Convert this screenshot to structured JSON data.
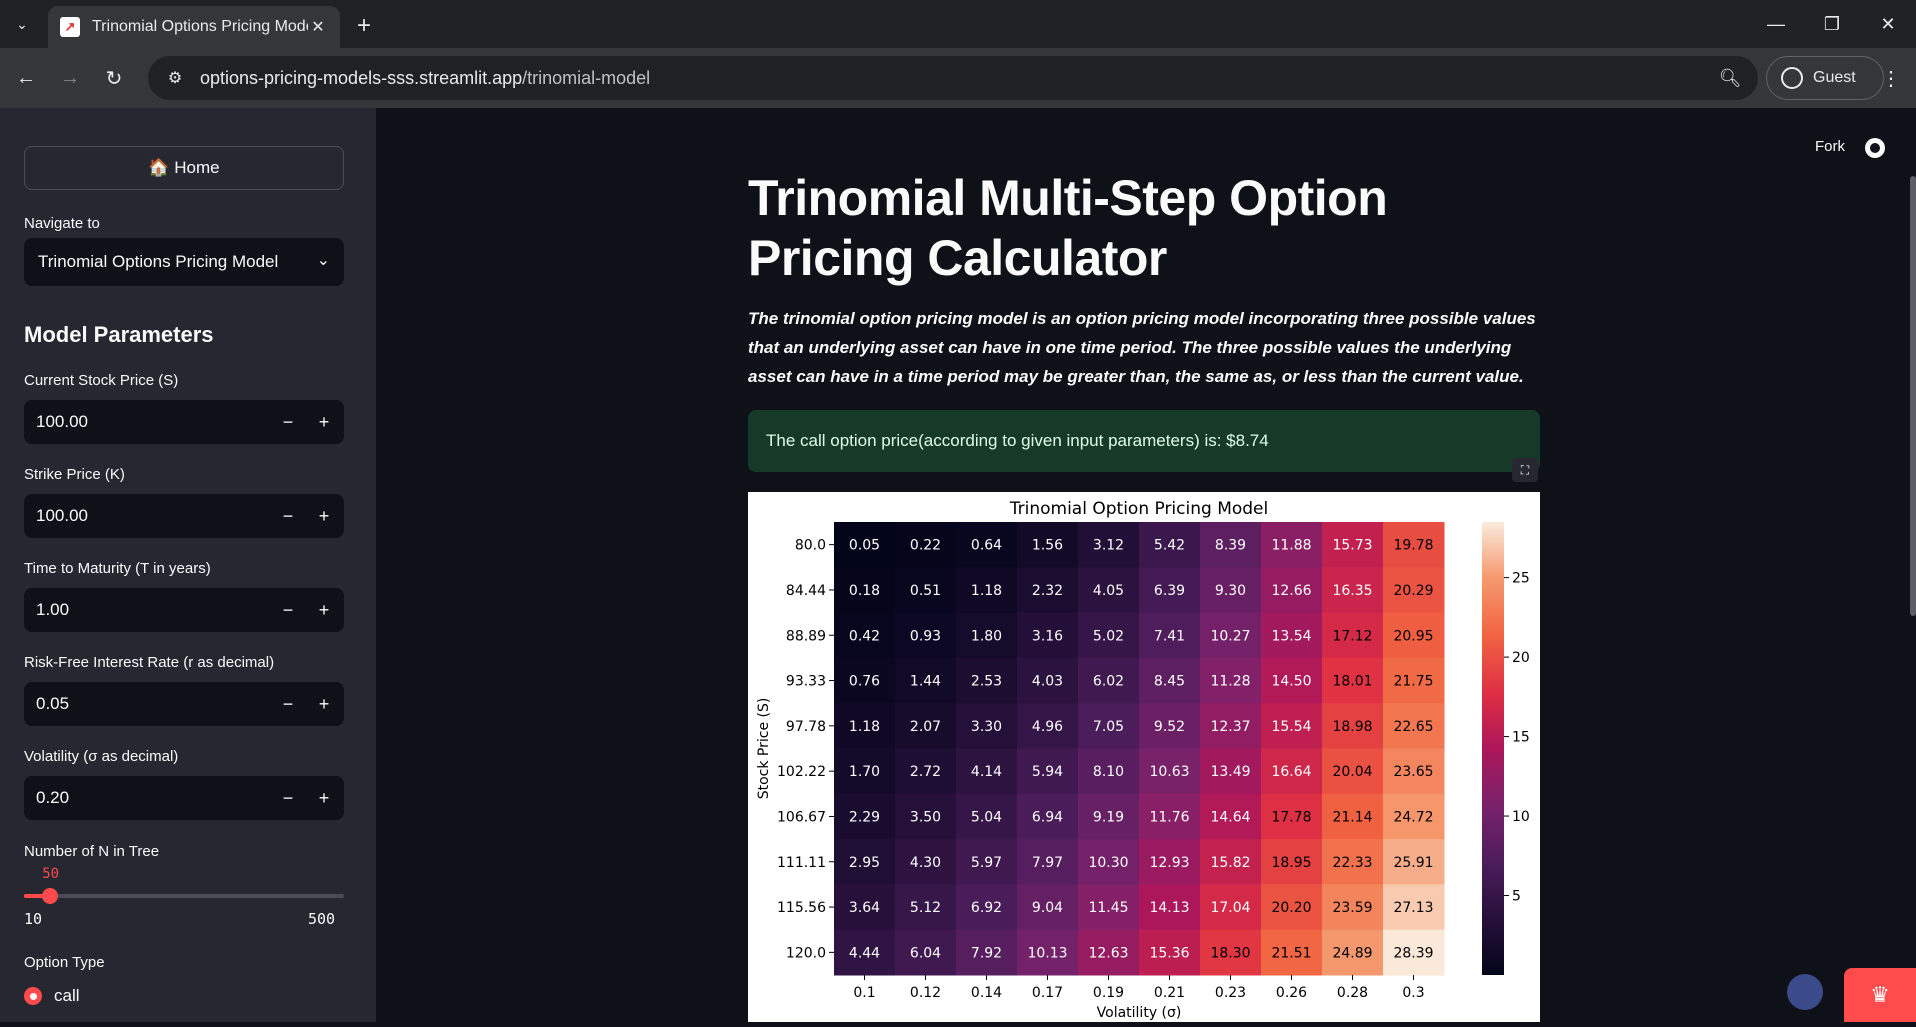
{
  "browser": {
    "tab_title": "Trinomial Options Pricing Mode",
    "url_host": "options-pricing-models-sss.streamlit.app",
    "url_path": "/trinomial-model",
    "profile_label": "Guest"
  },
  "sidebar": {
    "home_label": "🏠 Home",
    "navigate_label": "Navigate to",
    "navigate_value": "Trinomial Options Pricing Model",
    "section_title": "Model Parameters",
    "inputs": [
      {
        "label": "Current Stock Price (S)",
        "value": "100.00"
      },
      {
        "label": "Strike Price (K)",
        "value": "100.00"
      },
      {
        "label": "Time to Maturity (T in years)",
        "value": "1.00"
      },
      {
        "label": "Risk-Free Interest Rate (r as decimal)",
        "value": "0.05"
      },
      {
        "label": "Volatility (σ as decimal)",
        "value": "0.20"
      }
    ],
    "slider": {
      "label": "Number of N in Tree",
      "value": "50",
      "min": "10",
      "max": "500",
      "fraction": 0.082
    },
    "option_type_label": "Option Type",
    "option_type_value": "call"
  },
  "main": {
    "fork_label": "Fork",
    "title": "Trinomial Multi-Step Option Pricing Calculator",
    "description": "The trinomial option pricing model is an option pricing model incorporating three possible values that an underlying asset can have in one time period. The three possible values the underlying asset can have in a time period may be greater than, the same as, or less than the current value.",
    "result": "The call option price(according to given input parameters) is: $8.74"
  },
  "chart_data": {
    "type": "heatmap",
    "title": "Trinomial Option Pricing Model",
    "xlabel": "Volatility (σ)",
    "ylabel": "Stock Price (S)",
    "x": [
      "0.1",
      "0.12",
      "0.14",
      "0.17",
      "0.19",
      "0.21",
      "0.23",
      "0.26",
      "0.28",
      "0.3"
    ],
    "y": [
      "80.0",
      "84.44",
      "88.89",
      "93.33",
      "97.78",
      "102.22",
      "106.67",
      "111.11",
      "115.56",
      "120.0"
    ],
    "values": [
      [
        "0.05",
        "0.22",
        "0.64",
        "1.56",
        "3.12",
        "5.42",
        "8.39",
        "11.88",
        "15.73",
        "19.78"
      ],
      [
        "0.18",
        "0.51",
        "1.18",
        "2.32",
        "4.05",
        "6.39",
        "9.30",
        "12.66",
        "16.35",
        "20.29"
      ],
      [
        "0.42",
        "0.93",
        "1.80",
        "3.16",
        "5.02",
        "7.41",
        "10.27",
        "13.54",
        "17.12",
        "20.95"
      ],
      [
        "0.76",
        "1.44",
        "2.53",
        "4.03",
        "6.02",
        "8.45",
        "11.28",
        "14.50",
        "18.01",
        "21.75"
      ],
      [
        "1.18",
        "2.07",
        "3.30",
        "4.96",
        "7.05",
        "9.52",
        "12.37",
        "15.54",
        "18.98",
        "22.65"
      ],
      [
        "1.70",
        "2.72",
        "4.14",
        "5.94",
        "8.10",
        "10.63",
        "13.49",
        "16.64",
        "20.04",
        "23.65"
      ],
      [
        "2.29",
        "3.50",
        "5.04",
        "6.94",
        "9.19",
        "11.76",
        "14.64",
        "17.78",
        "21.14",
        "24.72"
      ],
      [
        "2.95",
        "4.30",
        "5.97",
        "7.97",
        "10.30",
        "12.93",
        "15.82",
        "18.95",
        "22.33",
        "25.91"
      ],
      [
        "3.64",
        "5.12",
        "6.92",
        "9.04",
        "11.45",
        "14.13",
        "17.04",
        "20.20",
        "23.59",
        "27.13"
      ],
      [
        "4.44",
        "6.04",
        "7.92",
        "10.13",
        "12.63",
        "15.36",
        "18.30",
        "21.51",
        "24.89",
        "28.39"
      ]
    ],
    "colorbar_ticks": [
      "5",
      "10",
      "15",
      "20",
      "25"
    ],
    "colorbar_range": [
      0,
      28.5
    ],
    "colormap": "rocket"
  }
}
